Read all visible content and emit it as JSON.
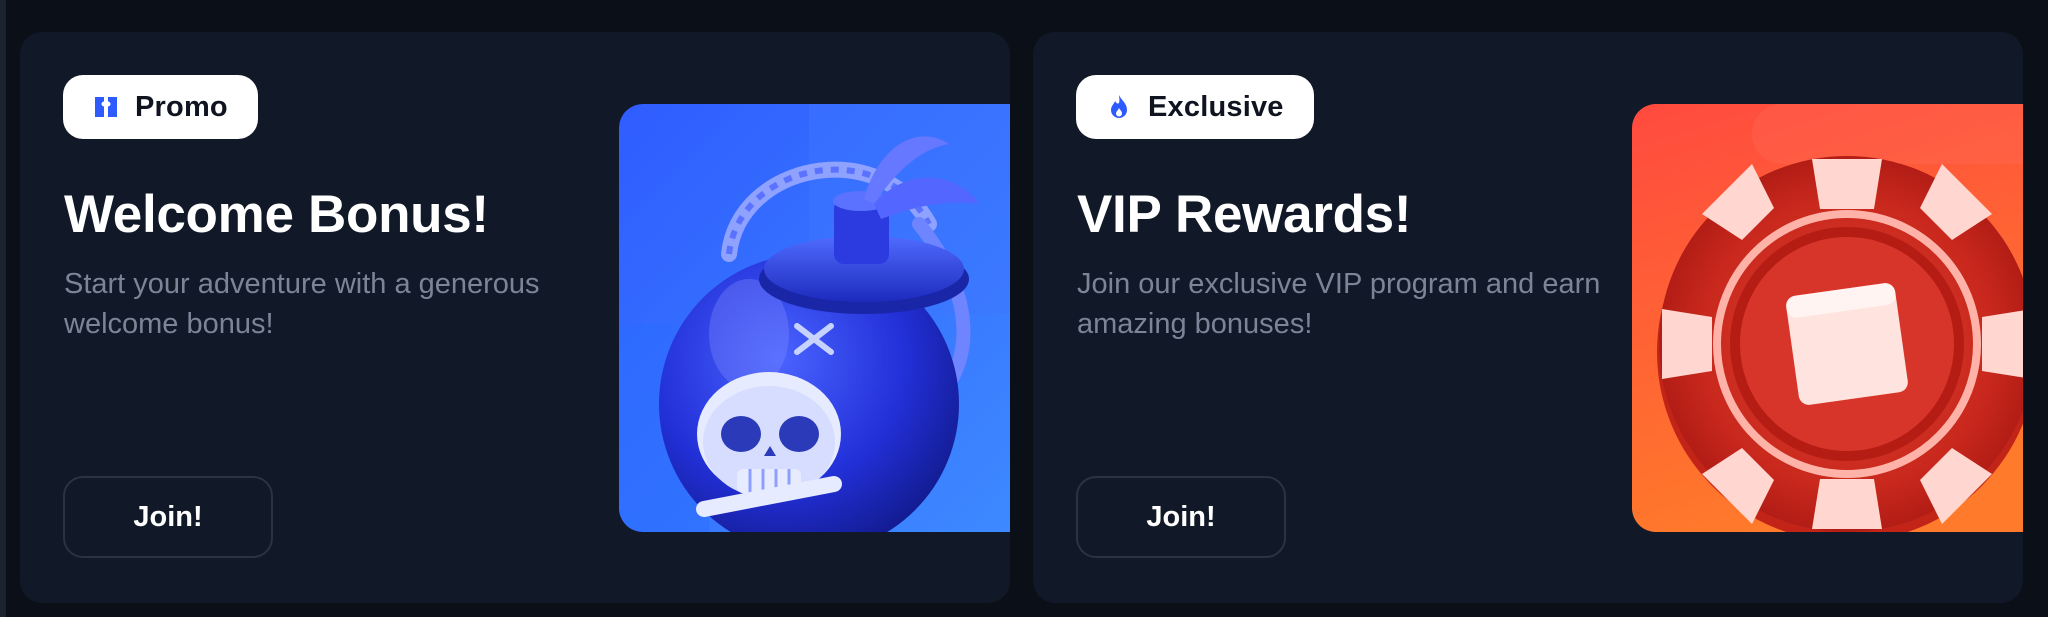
{
  "cards": [
    {
      "badge": {
        "label": "Promo",
        "icon": "ticket-icon",
        "icon_color": "#2d5bff"
      },
      "title": "Welcome Bonus!",
      "description": "Start your adventure with a generous welcome bonus!",
      "button_label": "Join!",
      "art": {
        "icon": "pirate-bomb-icon",
        "color": "#3b6bff"
      }
    },
    {
      "badge": {
        "label": "Exclusive",
        "icon": "flame-icon",
        "icon_color": "#2d5bff"
      },
      "title": "VIP Rewards!",
      "description": "Join our exclusive VIP program and earn amazing bonuses!",
      "button_label": "Join!",
      "art": {
        "icon": "casino-chip-icon",
        "color": "#ff4a3a"
      }
    }
  ],
  "colors": {
    "page_background": "#0b0f17",
    "card_background": "#111827",
    "title": "#ffffff",
    "description": "#7b8597",
    "button_border": "#2b3343"
  }
}
